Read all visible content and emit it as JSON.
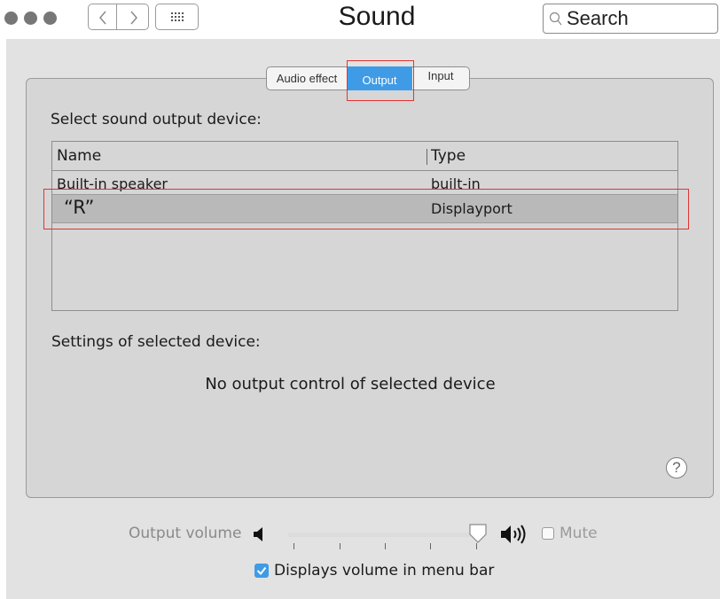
{
  "window": {
    "title": "Sound"
  },
  "search": {
    "placeholder": "Search"
  },
  "icons": {
    "traffic_lights": [
      "close-button-icon",
      "minimize-button-icon",
      "zoom-button-icon"
    ],
    "back": "chevron-left-icon",
    "forward": "chevron-right-icon",
    "show_all": "grid-icon",
    "search": "magnifier-icon",
    "volume_low": "speaker-low-icon",
    "volume_high": "speaker-high-icon",
    "help": "help-icon"
  },
  "tabs": [
    {
      "label": "Audio effect",
      "selected": false
    },
    {
      "label": "Output",
      "selected": true
    },
    {
      "label": "Input",
      "selected": false
    }
  ],
  "output": {
    "heading": "Select sound output device:",
    "table": {
      "columns": [
        "Name",
        "Type"
      ],
      "rows": [
        {
          "name": "Built-in speaker",
          "type": "built-in",
          "selected": false
        },
        {
          "name": "“R”",
          "type": "Displayport",
          "selected": true
        }
      ]
    },
    "settings_heading": "Settings of selected device:",
    "settings_message": "No output control of selected device",
    "help_label": "?"
  },
  "volume": {
    "label": "Output volume",
    "level": 1.0,
    "mute_label": "Mute",
    "mute_checked": false,
    "show_in_menu_bar_label": "Displays volume in  menu bar",
    "show_in_menu_bar_checked": true
  },
  "colors": {
    "accent": "#3f9be6",
    "highlight_outline": "#e23434",
    "pane_background": "#e2e2e2",
    "selected_row": "#b9b9b9"
  }
}
